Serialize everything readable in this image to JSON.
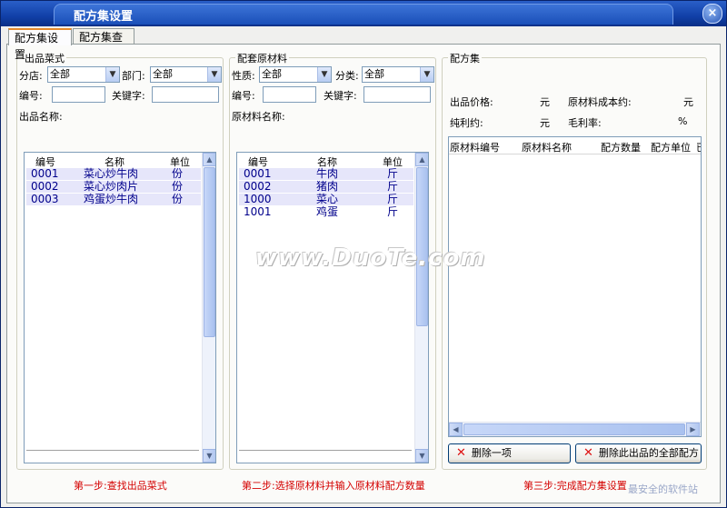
{
  "window": {
    "title": "配方集设置"
  },
  "tabs": [
    {
      "label": "配方集设置"
    },
    {
      "label": "配方集查询"
    }
  ],
  "dish_panel": {
    "title": "出品菜式",
    "branch_label": "分店:",
    "branch_value": "全部",
    "dept_label": "部门:",
    "dept_value": "全部",
    "code_label": "编号:",
    "keyword_label": "关键字:",
    "name_label": "出品名称:",
    "columns": [
      "编号",
      "名称",
      "单位"
    ],
    "rows": [
      [
        "0001",
        "菜心炒牛肉",
        "份"
      ],
      [
        "0002",
        "菜心炒肉片",
        "份"
      ],
      [
        "0003",
        "鸡蛋炒牛肉",
        "份"
      ]
    ]
  },
  "material_panel": {
    "title": "配套原材料",
    "nature_label": "性质:",
    "nature_value": "全部",
    "category_label": "分类:",
    "category_value": "全部",
    "code_label": "编号:",
    "keyword_label": "关键字:",
    "name_label": "原材料名称:",
    "columns": [
      "编号",
      "名称",
      "单位"
    ],
    "rows": [
      [
        "0001",
        "牛肉",
        "斤"
      ],
      [
        "0002",
        "猪肉",
        "斤"
      ],
      [
        "1000",
        "菜心",
        "斤"
      ],
      [
        "1001",
        "鸡蛋",
        "斤"
      ]
    ]
  },
  "recipe_panel": {
    "title": "配方集",
    "price_label": "出品价格:",
    "price_unit": "元",
    "cost_label": "原材料成本约:",
    "cost_unit": "元",
    "profit_label": "纯利约:",
    "profit_unit": "元",
    "margin_label": "毛利率:",
    "margin_unit": "%",
    "columns": [
      "原材料编号",
      "原材料名称",
      "配方数量",
      "配方单位",
      "已"
    ],
    "delete_one_label": "删除一项",
    "delete_all_label": "删除此出品的全部配方"
  },
  "steps": [
    "第一步:查找出品菜式",
    "第二步:选择原材料并输入原材料配方数量",
    "第三步:完成配方集设置"
  ],
  "watermark": "www.DuoTe.com",
  "corner_watermark": "最安全的软件站",
  "colors": {
    "step_text": "#d40000",
    "row_text": "#00008b",
    "row_bg": "#e6e6fa",
    "title_bar": "#1140a8"
  }
}
